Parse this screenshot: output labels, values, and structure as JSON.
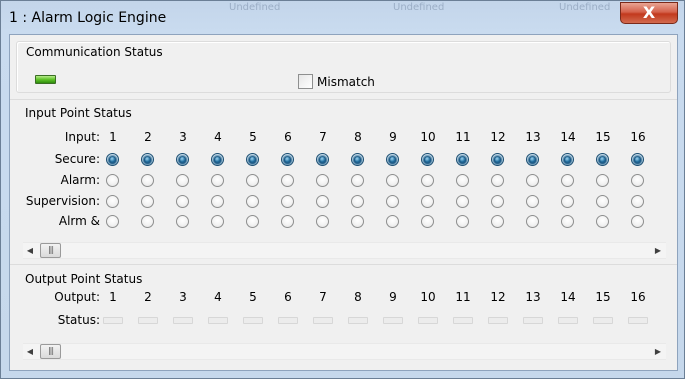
{
  "window": {
    "title": "1 : Alarm Logic Engine",
    "close_glyph": "X",
    "ghost_text": [
      "Undefined",
      "Undefined",
      "Undefined"
    ]
  },
  "communication": {
    "group_title": "Communication Status",
    "indicator_color": "#5fc328",
    "mismatch_label": "Mismatch",
    "mismatch_checked": false
  },
  "inputs": {
    "group_title": "Input Point Status",
    "row_labels": {
      "input": "Input:",
      "secure": "Secure:",
      "alarm": "Alarm:",
      "supervision": "Supervision:",
      "alrm": "Alrm &"
    },
    "columns": [
      "1",
      "2",
      "3",
      "4",
      "5",
      "6",
      "7",
      "8",
      "9",
      "10",
      "11",
      "12",
      "13",
      "14",
      "15",
      "16"
    ],
    "secure_selected": [
      true,
      true,
      true,
      true,
      true,
      true,
      true,
      true,
      true,
      true,
      true,
      true,
      true,
      true,
      true,
      true
    ]
  },
  "outputs": {
    "group_title": "Output Point Status",
    "row_labels": {
      "output": "Output:",
      "status": "Status:"
    },
    "columns": [
      "1",
      "2",
      "3",
      "4",
      "5",
      "6",
      "7",
      "8",
      "9",
      "10",
      "11",
      "12",
      "13",
      "14",
      "15",
      "16"
    ]
  },
  "scroll": {
    "left_arrow": "◀",
    "right_arrow": "▶",
    "thumb_grip": "|||"
  }
}
